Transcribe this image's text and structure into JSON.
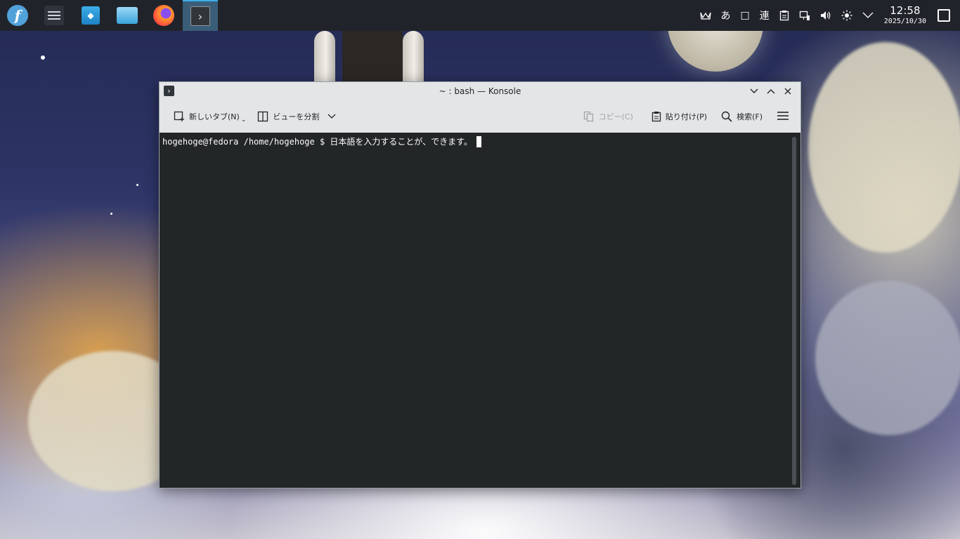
{
  "taskbar": {
    "launchers": [
      {
        "name": "fedora-menu",
        "glyph": "f"
      },
      {
        "name": "system-settings"
      },
      {
        "name": "discover-store"
      },
      {
        "name": "dolphin-files"
      },
      {
        "name": "firefox"
      },
      {
        "name": "konsole",
        "active": true
      }
    ],
    "tray": {
      "input_method_hiragana": "あ",
      "input_method_square": "□",
      "input_method_ren": "連",
      "clock_time": "12:58",
      "clock_date": "2025/10/30"
    }
  },
  "window": {
    "title": "~ : bash — Konsole",
    "toolbar": {
      "new_tab": "新しいタブ(N)",
      "split_view": "ビューを分割",
      "copy": "コピー(C)",
      "paste": "貼り付け(P)",
      "find": "検索(F)"
    },
    "terminal": {
      "prompt": "hogehoge@fedora /home/hogehoge $ ",
      "input": "日本語を入力することが、できます。"
    }
  },
  "colors": {
    "taskbar_bg": "#20242a",
    "terminal_bg": "#232627",
    "accent": "#3daee9"
  }
}
